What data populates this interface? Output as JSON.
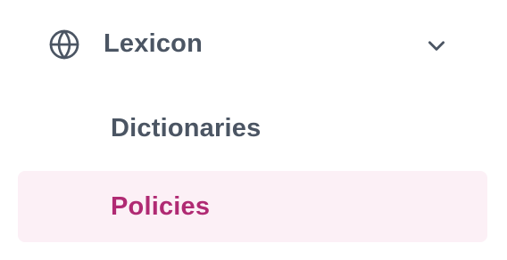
{
  "nav": {
    "group": {
      "label": "Lexicon",
      "icon": "globe-icon",
      "toggle_icon": "chevron-down-icon",
      "expanded": true
    },
    "items": [
      {
        "label": "Dictionaries",
        "active": false
      },
      {
        "label": "Policies",
        "active": true
      }
    ]
  },
  "colors": {
    "text": "#4b5563",
    "active_text": "#b02a73",
    "active_background": "#fcf0f6"
  }
}
